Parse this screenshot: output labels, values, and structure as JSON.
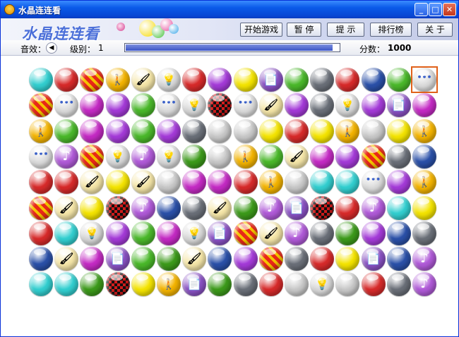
{
  "window": {
    "title": "水晶连连看"
  },
  "title_buttons": {
    "minimize": "_",
    "maximize": "□",
    "close": "✕"
  },
  "banner": {
    "logo_text": "水晶连连看"
  },
  "menu": {
    "start": "开始游戏",
    "pause": "暂 停",
    "hint": "提 示",
    "ranking": "排行榜",
    "about": "关 于"
  },
  "status": {
    "sound_label": "音效：",
    "level_label": "级别：",
    "level_value": "1",
    "time_remaining_fraction": 0.97,
    "score_label": "分数：",
    "score_value": "1000"
  },
  "board": {
    "rows": 9,
    "cols": 16,
    "selected": {
      "row": 0,
      "col": 15
    },
    "tile_types": {
      "cyan": {
        "icon": "cyan-gem",
        "color": "#32cfd0",
        "symbol": ""
      },
      "zipred": {
        "icon": "red-zipper-ball",
        "color": "#d72a2a",
        "symbol": ""
      },
      "stripe": {
        "icon": "red-striped-ball",
        "color": "#e23020",
        "symbol": ""
      },
      "walk": {
        "icon": "walker-sign-ball",
        "color": "#f4b400",
        "symbol": "🚶"
      },
      "brush": {
        "icon": "paintbrush-ball",
        "color": "#f5e6a8",
        "symbol": "🖌"
      },
      "bulb": {
        "icon": "green-bulb-ball",
        "color": "#d8d8d8",
        "symbol": "💡"
      },
      "purple": {
        "icon": "purple-gem",
        "color": "#a43ad8",
        "symbol": ""
      },
      "yellow": {
        "icon": "yellow-gem",
        "color": "#f4e400",
        "symbol": ""
      },
      "doc": {
        "icon": "document-ball",
        "color": "#8a52c4",
        "symbol": "📄"
      },
      "drip": {
        "icon": "green-drip-ball",
        "color": "#4ab82a",
        "symbol": ""
      },
      "zipgry": {
        "icon": "grey-zipper-ball",
        "color": "#6a6f78",
        "symbol": ""
      },
      "zipblu": {
        "icon": "blue-zipper-ball",
        "color": "#2a50a8",
        "symbol": ""
      },
      "mdrip": {
        "icon": "magenta-drip-ball",
        "color": "#c42ac4",
        "symbol": ""
      },
      "gray": {
        "icon": "silver-gem",
        "color": "#c8c8c8",
        "symbol": ""
      },
      "dots": {
        "icon": "dots-ball",
        "color": "#dcdcdc",
        "symbol": "•••"
      },
      "music": {
        "icon": "music-note-ball",
        "color": "#b05ad8",
        "symbol": "♪"
      },
      "dgreen": {
        "icon": "green-gem",
        "color": "#3c9a1a",
        "symbol": ""
      },
      "checker": {
        "icon": "checker-ball",
        "color": "#b01818",
        "symbol": ""
      }
    },
    "grid": [
      [
        "cyan",
        "zipred",
        "stripe",
        "walk",
        "brush",
        "bulb",
        "zipred",
        "purple",
        "yellow",
        "doc",
        "drip",
        "zipgry",
        "zipred",
        "zipblu",
        "drip",
        "dots"
      ],
      [
        "stripe",
        "dots",
        "mdrip",
        "purple",
        "drip",
        "dots",
        "bulb",
        "checker",
        "dots",
        "brush",
        "purple",
        "zipgry",
        "bulb",
        "purple",
        "doc",
        "mdrip"
      ],
      [
        "walk",
        "drip",
        "mdrip",
        "purple",
        "drip",
        "purple",
        "zipgry",
        "gray",
        "gray",
        "yellow",
        "zipred",
        "yellow",
        "walk",
        "gray",
        "yellow",
        "walk"
      ],
      [
        "dots",
        "music",
        "stripe",
        "bulb",
        "music",
        "bulb",
        "dgreen",
        "gray",
        "walk",
        "drip",
        "brush",
        "mdrip",
        "purple",
        "stripe",
        "zipgry",
        "zipblu"
      ],
      [
        "zipred",
        "zipred",
        "brush",
        "yellow",
        "brush",
        "gray",
        "mdrip",
        "mdrip",
        "zipred",
        "walk",
        "gray",
        "cyan",
        "cyan",
        "dots",
        "purple",
        "walk"
      ],
      [
        "stripe",
        "brush",
        "yellow",
        "checker",
        "music",
        "zipblu",
        "zipgry",
        "brush",
        "dgreen",
        "music",
        "doc",
        "checker",
        "zipred",
        "music",
        "cyan",
        "yellow"
      ],
      [
        "zipred",
        "cyan",
        "bulb",
        "purple",
        "drip",
        "mdrip",
        "bulb",
        "doc",
        "stripe",
        "brush",
        "music",
        "zipgry",
        "dgreen",
        "purple",
        "zipblu",
        "zipgry"
      ],
      [
        "zipblu",
        "brush",
        "mdrip",
        "doc",
        "drip",
        "dgreen",
        "brush",
        "zipblu",
        "purple",
        "stripe",
        "zipgry",
        "zipred",
        "yellow",
        "doc",
        "zipblu",
        "music"
      ],
      [
        "cyan",
        "cyan",
        "dgreen",
        "checker",
        "yellow",
        "walk",
        "doc",
        "dgreen",
        "zipgry",
        "zipred",
        "gray",
        "bulb",
        "gray",
        "zipred",
        "zipgry",
        "music"
      ]
    ]
  }
}
